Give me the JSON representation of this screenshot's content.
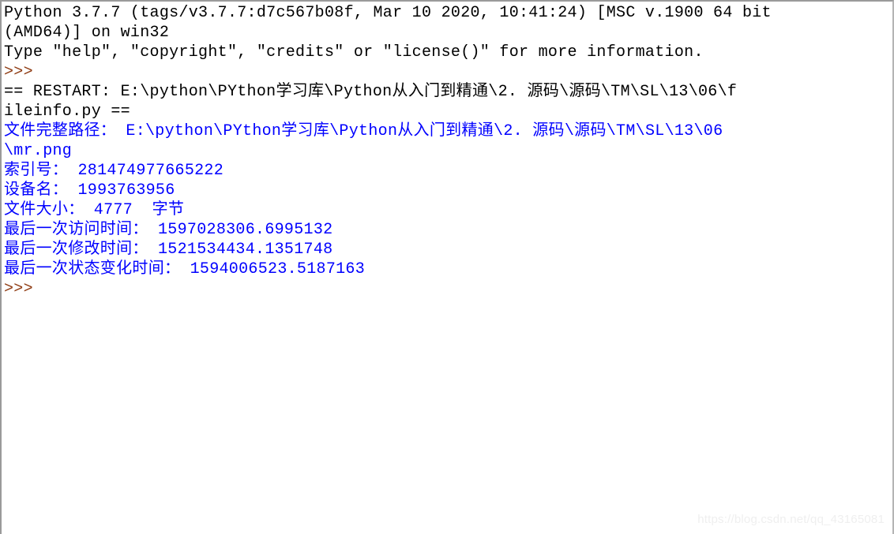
{
  "window": {
    "app": "Python IDLE Shell",
    "border_color": "#9a9a9a",
    "background": "#ffffff"
  },
  "colors": {
    "banner_text": "#000000",
    "prompt": "#8f3b12",
    "stdout": "#0000ff",
    "watermark": "#efefef"
  },
  "shell": {
    "lines": [
      {
        "kind": "banner",
        "text": "Python 3.7.7 (tags/v3.7.7:d7c567b08f, Mar 10 2020, 10:41:24) [MSC v.1900 64 bit"
      },
      {
        "kind": "banner",
        "text": "(AMD64)] on win32"
      },
      {
        "kind": "banner",
        "text": "Type \"help\", \"copyright\", \"credits\" or \"license()\" for more information."
      },
      {
        "kind": "prompt",
        "text": ">>>"
      },
      {
        "kind": "restart",
        "text": "== RESTART: E:\\python\\PYthon学习库\\Python从入门到精通\\2. 源码\\源码\\TM\\SL\\13\\06\\f"
      },
      {
        "kind": "restart",
        "text": "ileinfo.py =="
      },
      {
        "kind": "stdout",
        "text": "文件完整路径： E:\\python\\PYthon学习库\\Python从入门到精通\\2. 源码\\源码\\TM\\SL\\13\\06"
      },
      {
        "kind": "stdout",
        "text": "\\mr.png"
      },
      {
        "kind": "stdout",
        "text": "索引号： 281474977665222"
      },
      {
        "kind": "stdout",
        "text": "设备名： 1993763956"
      },
      {
        "kind": "stdout",
        "text": "文件大小： 4777  字节"
      },
      {
        "kind": "stdout",
        "text": "最后一次访问时间： 1597028306.6995132"
      },
      {
        "kind": "stdout",
        "text": "最后一次修改时间： 1521534434.1351748"
      },
      {
        "kind": "stdout",
        "text": "最后一次状态变化时间： 1594006523.5187163"
      },
      {
        "kind": "prompt",
        "text": ">>>"
      }
    ]
  },
  "program_output": {
    "full_path_label": "文件完整路径：",
    "full_path_value": "E:\\python\\PYthon学习库\\Python从入门到精通\\2. 源码\\源码\\TM\\SL\\13\\06\\mr.png",
    "inode_label": "索引号：",
    "inode_value": "281474977665222",
    "device_label": "设备名：",
    "device_value": "1993763956",
    "size_label": "文件大小：",
    "size_value": "4777",
    "size_unit": "字节",
    "atime_label": "最后一次访问时间：",
    "atime_value": "1597028306.6995132",
    "mtime_label": "最后一次修改时间：",
    "mtime_value": "1521534434.1351748",
    "ctime_label": "最后一次状态变化时间：",
    "ctime_value": "1594006523.5187163"
  },
  "restart": {
    "script_path": "E:\\python\\PYthon学习库\\Python从入门到精通\\2. 源码\\源码\\TM\\SL\\13\\06\\fileinfo.py"
  },
  "watermark": {
    "text": "https://blog.csdn.net/qq_43165081"
  }
}
